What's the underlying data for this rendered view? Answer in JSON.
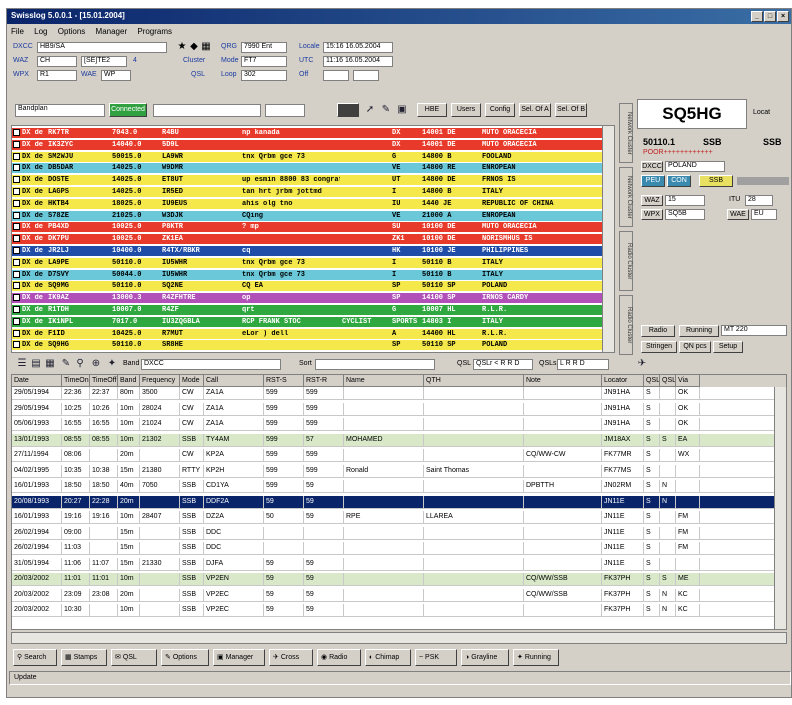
{
  "window": {
    "title": "Swisslog 5.0.0.1 - [15.01.2004]"
  },
  "menu": [
    "File",
    "Log",
    "Options",
    "Manager",
    "Programs"
  ],
  "station": {
    "call_label": "DXCC",
    "call_value": "HB9/SA",
    "waz_label": "WAZ",
    "waz_value": "CH",
    "waz_extra": "[SE]TE2",
    "waz_n": "4",
    "wpx_label": "WPX",
    "wpx_value": "R1",
    "wpx_side_label": "WAE",
    "wpx_side_value": "WP",
    "cluster_label": "Cluster",
    "qsl_label": "QSL",
    "qrg_label": "QRG",
    "qrg_value": "7990 Ent",
    "mode_label": "Mode",
    "mode_value": "FT7",
    "loop_label": "Loop",
    "loop_value": "302",
    "local_label": "Locale",
    "local_value": "15:16 16.05.2004",
    "utc_label": "UTC",
    "utc_value": "11:16 16.05.2004",
    "off_label": "Off"
  },
  "cluster_toolbar": {
    "band_select": "Bandplan",
    "filter_btn": "Connected",
    "btns": [
      "HBE",
      "Users",
      "Config",
      "Sel. Of A",
      "Sel. Of B"
    ]
  },
  "cluster_rows": [
    {
      "c": [
        "DX de",
        "RK7TR",
        "7043.0",
        "R4BU",
        "np kanada",
        "",
        "DX",
        "14001 DE",
        "MUTO ORACECIA"
      ],
      "bg": "#e83a2a",
      "fg": "#fff"
    },
    {
      "c": [
        "DX de",
        "IK3ZYC",
        "14040.0",
        "5D9L",
        "",
        "",
        "DX",
        "14001 DE",
        "MUTO ORACECIA"
      ],
      "bg": "#e83a2a",
      "fg": "#fff"
    },
    {
      "c": [
        "DX de",
        "SM2WJU",
        "50015.0",
        "LA9WR",
        "tnx Qrbm gce 73",
        "",
        "G",
        "14800 B",
        "FOOLAND"
      ],
      "bg": "#f4e84a",
      "fg": "#000"
    },
    {
      "c": [
        "DX de",
        "DB5DAR",
        "14025.0",
        "W9DMR",
        "",
        "",
        "VE",
        "14800 RE",
        "ENROPEAN"
      ],
      "bg": "#6ac8d8",
      "fg": "#000"
    },
    {
      "c": [
        "DX de",
        "DOSTE",
        "14025.0",
        "ET8UT",
        "up esmin 8800 83 congrats",
        "",
        "UT",
        "14800 DE",
        "FRNOS IS"
      ],
      "bg": "#f4e84a",
      "fg": "#000"
    },
    {
      "c": [
        "DX de",
        "LAGPS",
        "14025.0",
        "IR5ED",
        "tan hrt jrbm jottmd",
        "",
        "I",
        "14800 B",
        "ITALY"
      ],
      "bg": "#f4e84a",
      "fg": "#000"
    },
    {
      "c": [
        "DX de",
        "HKTB4",
        "18025.0",
        "IU9EUS",
        "ahis olg tno",
        "",
        "IU",
        "1440 JE",
        "REPUBLIC OF CHINA"
      ],
      "bg": "#f4e84a",
      "fg": "#000"
    },
    {
      "c": [
        "DX de",
        "S78ZE",
        "21025.0",
        "W3DJK",
        "CQing",
        "",
        "VE",
        "21000 A",
        "ENROPEAN"
      ],
      "bg": "#6ac8d8",
      "fg": "#000"
    },
    {
      "c": [
        "DX de",
        "PB4XD",
        "10025.0",
        "P8KTR",
        "? mp",
        "",
        "SU",
        "10100 DE",
        "MUTO ORACECIA"
      ],
      "bg": "#e83a2a",
      "fg": "#fff"
    },
    {
      "c": [
        "DX de",
        "DK7PU",
        "10025.0",
        "ZK1EA",
        "",
        "",
        "ZK1",
        "10100 DE",
        "NORISMHUS IS"
      ],
      "bg": "#e83a2a",
      "fg": "#fff"
    },
    {
      "c": [
        "DX de",
        "JR2LJ",
        "10400.0",
        "R4TX/RBKR",
        "cq",
        "",
        "HK",
        "10100 JE",
        "PHILIPPINES"
      ],
      "bg": "#1f4da8",
      "fg": "#fff"
    },
    {
      "c": [
        "DX de",
        "LA9PE",
        "50110.0",
        "IU5WHR",
        "tnx Qrbm gce 73",
        "",
        "I",
        "50110 B",
        "ITALY"
      ],
      "bg": "#f4e84a",
      "fg": "#000"
    },
    {
      "c": [
        "DX de",
        "D7SVY",
        "50044.0",
        "IU5WHR",
        "tnx Qrbm gce 73",
        "",
        "I",
        "50110 B",
        "ITALY"
      ],
      "bg": "#6ac8d8",
      "fg": "#000"
    },
    {
      "c": [
        "DX de",
        "SQ9MG",
        "50110.0",
        "SQ2NE",
        "CQ EA",
        "",
        "SP",
        "50110 SP",
        "POLAND"
      ],
      "bg": "#f4e84a",
      "fg": "#000"
    },
    {
      "c": [
        "DX de",
        "IK9AZ",
        "13000.3",
        "R4ZFHTRE",
        "op",
        "",
        "SP",
        "14100 SP",
        "IRNOS CARDY"
      ],
      "bg": "#b050b8",
      "fg": "#fff"
    },
    {
      "c": [
        "DX de",
        "R1TDH",
        "10007.0",
        "R4ZF",
        "qrt",
        "",
        "G",
        "10007 HL",
        "R.L.R."
      ],
      "bg": "#30a840",
      "fg": "#fff"
    },
    {
      "c": [
        "DX de",
        "IK1NPL",
        "7017.0",
        "IU3ZQGBLA",
        "RCP FRANK STOC",
        "CYCLIST",
        "SPORTS",
        "14803 I",
        "ITALY"
      ],
      "bg": "#30a840",
      "fg": "#fff"
    },
    {
      "c": [
        "DX de",
        "F1ID",
        "10425.0",
        "R7MUT",
        "eLor ) dell",
        "",
        "A",
        "14400 HL",
        "R.L.R."
      ],
      "bg": "#f4e84a",
      "fg": "#000"
    },
    {
      "c": [
        "DX de",
        "SQ9HG",
        "50110.0",
        "SR8HE",
        "",
        "",
        "SP",
        "50110 SP",
        "POLAND"
      ],
      "bg": "#f4e84a",
      "fg": "#000"
    }
  ],
  "side_tabs": [
    "Network Cluster",
    "Network Cluster",
    "Radio Cluster",
    "Radio Cluster"
  ],
  "right_panel": {
    "callsign": "SQ5HG",
    "local_label": "Locat",
    "freq": "50110.1",
    "mode1": "SSB",
    "mode2": "SSB",
    "stars": "POOR++++++++++++",
    "dxcc_lbl": "DXCC",
    "dxcc_val": "POLAND",
    "chips": [
      "PEU",
      "CON",
      "SSB"
    ],
    "waz_lbl": "WAZ",
    "waz_val": "15",
    "itu_lbl": "ITU",
    "itu_val": "28",
    "wpx_lbl": "WPX",
    "wpx_val": "SQ5B",
    "wae_lbl": "WAE",
    "wae_val": "EU",
    "radio_btn": "Radio",
    "running_btn": "Running",
    "running_val": "MT 220",
    "b1": "Stringen",
    "b2": "QN pcs",
    "b3": "Setup"
  },
  "log_toolbar": {
    "band_label": "Band",
    "band_value": "DXCC",
    "sort_label": "Sort",
    "sort_value": "",
    "qsl_label": "QSL",
    "qsl_text": "QSLr < R R D",
    "qsls_label": "QSLs",
    "qsls_text": "L R R D"
  },
  "log_columns": [
    "Date",
    "TimeOn",
    "TimeOff",
    "Band",
    "Frequency",
    "Mode",
    "Call",
    "RST-S",
    "RST-R",
    "Name",
    "QTH",
    "Note",
    "Locator",
    "QSL-S",
    "QSL-R",
    "Via"
  ],
  "log_rows": [
    {
      "c": [
        "29/05/1994",
        "22:36",
        "22:37",
        "80m",
        "3500",
        "CW",
        "ZA1A",
        "599",
        "599",
        "",
        "",
        "",
        "JN91HA",
        "S",
        "",
        "OK"
      ],
      "s": ""
    },
    {
      "c": [
        "29/05/1994",
        "10:25",
        "10:26",
        "10m",
        "28024",
        "CW",
        "ZA1A",
        "599",
        "599",
        "",
        "",
        "",
        "JN91HA",
        "S",
        "",
        "OK"
      ],
      "s": ""
    },
    {
      "c": [
        "05/06/1993",
        "16:55",
        "16:55",
        "10m",
        "21024",
        "CW",
        "ZA1A",
        "599",
        "599",
        "",
        "",
        "",
        "JN91HA",
        "S",
        "",
        "OK"
      ],
      "s": ""
    },
    {
      "c": [
        "13/01/1993",
        "08:55",
        "08:55",
        "10m",
        "21302",
        "SSB",
        "TY4AM",
        "599",
        "57",
        "MOHAMED",
        "",
        "",
        "JM18AX",
        "S",
        "S",
        "EA"
      ],
      "s": "green"
    },
    {
      "c": [
        "27/11/1994",
        "08:06",
        "",
        "20m",
        "",
        "CW",
        "KP2A",
        "599",
        "599",
        "",
        "",
        "CQ/WW-CW",
        "FK77MR",
        "S",
        "",
        "WX"
      ],
      "s": ""
    },
    {
      "c": [
        "04/02/1995",
        "10:35",
        "10:38",
        "15m",
        "21380",
        "RTTY",
        "KP2H",
        "599",
        "599",
        "Ronald",
        "Saint Thomas",
        "",
        "FK77MS",
        "S",
        "",
        ""
      ],
      "s": ""
    },
    {
      "c": [
        "16/01/1993",
        "18:50",
        "18:50",
        "40m",
        "7050",
        "SSB",
        "CD1YA",
        "599",
        "59",
        "",
        "",
        "DPBTTH",
        "JN02RM",
        "S",
        "N",
        ""
      ],
      "s": ""
    },
    {
      "c": [
        "20/08/1993",
        "20:27",
        "22:28",
        "20m",
        "",
        "SSB",
        "DDF2A",
        "59",
        "59",
        "",
        "",
        "",
        "JN11E",
        "S",
        "N",
        ""
      ],
      "s": "sel"
    },
    {
      "c": [
        "16/01/1993",
        "19:16",
        "19:16",
        "10m",
        "28407",
        "SSB",
        "DZ2A",
        "50",
        "59",
        "RPE",
        "LLAREA",
        "",
        "JN11E",
        "S",
        "",
        "FM"
      ],
      "s": ""
    },
    {
      "c": [
        "26/02/1994",
        "09:00",
        "",
        "15m",
        "",
        "SSB",
        "DDC",
        "",
        "",
        "",
        "",
        "",
        "JN11E",
        "S",
        "",
        "FM"
      ],
      "s": ""
    },
    {
      "c": [
        "26/02/1994",
        "11:03",
        "",
        "15m",
        "",
        "SSB",
        "DDC",
        "",
        "",
        "",
        "",
        "",
        "JN11E",
        "S",
        "",
        "FM"
      ],
      "s": ""
    },
    {
      "c": [
        "31/05/1994",
        "11:06",
        "11:07",
        "15m",
        "21330",
        "SSB",
        "DJFA",
        "59",
        "59",
        "",
        "",
        "",
        "JN11E",
        "S",
        "",
        ""
      ],
      "s": ""
    },
    {
      "c": [
        "20/03/2002",
        "11:01",
        "11:01",
        "10m",
        "",
        "SSB",
        "VP2EN",
        "59",
        "59",
        "",
        "",
        "CQ/WW/SSB",
        "FK37PH",
        "S",
        "S",
        "ME"
      ],
      "s": "green"
    },
    {
      "c": [
        "20/03/2002",
        "23:09",
        "23:08",
        "20m",
        "",
        "SSB",
        "VP2EC",
        "59",
        "59",
        "",
        "",
        "CQ/WW/SSB",
        "FK37PH",
        "S",
        "N",
        "KC"
      ],
      "s": ""
    },
    {
      "c": [
        "20/03/2002",
        "10:30",
        "",
        "10m",
        "",
        "SSB",
        "VP2EC",
        "59",
        "59",
        "",
        "",
        "",
        "FK37PH",
        "S",
        "N",
        "KC"
      ],
      "s": ""
    }
  ],
  "bottom_buttons": [
    "Search",
    "Stamps",
    "QSL",
    "Options",
    "Manager",
    "Cross",
    "Radio",
    "Chimap",
    "PSK",
    "Grayline",
    "Running"
  ],
  "status": "Update"
}
